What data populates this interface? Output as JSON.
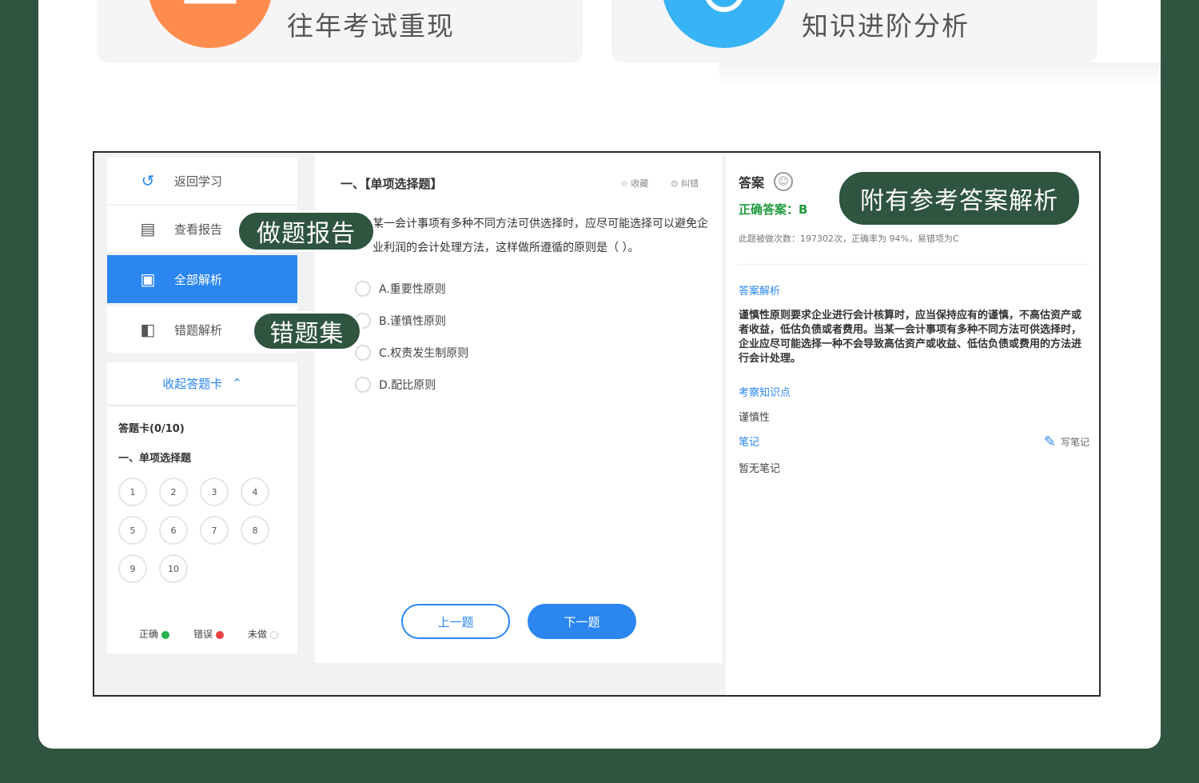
{
  "features": [
    {
      "label": "往年考试重现",
      "color": "#ff8c4f",
      "icon": "book-icon"
    },
    {
      "label": "知识进阶分析",
      "color": "#38b3f5",
      "icon": "ring-icon"
    }
  ],
  "sidebar": {
    "items": [
      {
        "label": "返回学习",
        "icon": "back-arrow-icon"
      },
      {
        "label": "查看报告",
        "icon": "report-icon"
      },
      {
        "label": "全部解析",
        "icon": "analysis-icon"
      },
      {
        "label": "错题解析",
        "icon": "wrong-analysis-icon"
      }
    ],
    "collapse_label": "收起答题卡",
    "answer_card": "答题卡(0/10)",
    "section": "一、单项选择题",
    "numbers": [
      "1",
      "2",
      "3",
      "4",
      "5",
      "6",
      "7",
      "8",
      "9",
      "10"
    ],
    "legend": [
      {
        "label": "正确",
        "color": "#22b14c"
      },
      {
        "label": "错误",
        "color": "#f04040"
      },
      {
        "label": "未做",
        "color": "#ffffff"
      }
    ]
  },
  "question": {
    "type": "一、【单项选择题】",
    "collect": "收藏",
    "report_error": "纠错",
    "text": "某一会计事项有多种不同方法可供选择时，应尽可能选择可以避免企业利润的会计处理方法，这样做所遵循的原则是（ ）。",
    "options": [
      "A.重要性原则",
      "B.谨慎性原则",
      "C.权责发生制原则",
      "D.配比原则"
    ],
    "prev": "上一题",
    "next": "下一题"
  },
  "answer": {
    "title": "答案",
    "correct": "正确答案：B",
    "stats": "此题被做次数：197302次，正确率为 94%，易错项为C",
    "analysis_title": "答案解析",
    "analysis": "谨慎性原则要求企业进行会计核算时，应当保持应有的谨慎，不高估资产或者收益，低估负债或者费用。当某一会计事项有多种不同方法可供选择时，企业应尽可能选择一种不会导致高估资产或收益、低估负债或费用的方法进行会计处理。",
    "knowledge_title": "考察知识点",
    "knowledge": "谨慎性",
    "notes_title": "笔记",
    "write_note": "写笔记",
    "notes": "暂无笔记"
  },
  "callouts": {
    "report": "做题报告",
    "wrong_set": "错题集",
    "reference": "附有参考答案解析"
  }
}
